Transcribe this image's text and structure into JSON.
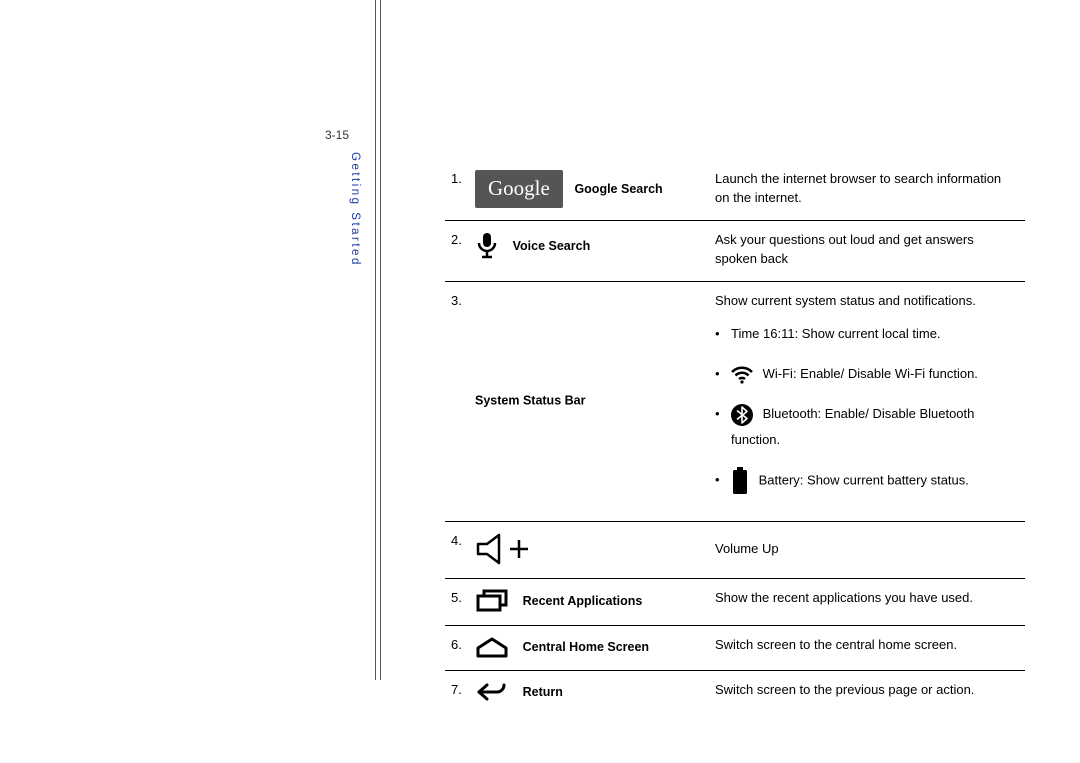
{
  "page_number": "3-15",
  "section_title": "Getting Started",
  "items": [
    {
      "num": "1.",
      "label": "Google Search",
      "logo_text": "Google",
      "desc": "Launch the internet browser to search information on the internet."
    },
    {
      "num": "2.",
      "label": "Voice Search",
      "desc": "Ask your questions out loud and get answers spoken back"
    },
    {
      "num": "3.",
      "label": "System Status Bar",
      "desc": "Show current system status and notifications.",
      "bullets": {
        "time": "Time 16:11: Show current local time.",
        "wifi": "Wi-Fi: Enable/ Disable Wi-Fi function.",
        "bt": "Bluetooth: Enable/ Disable Bluetooth function.",
        "batt": "Battery: Show current battery status."
      }
    },
    {
      "num": "4.",
      "label": "",
      "desc": "Volume Up"
    },
    {
      "num": "5.",
      "label": "Recent Applications",
      "desc": "Show the recent applications you have used."
    },
    {
      "num": "6.",
      "label": "Central Home Screen",
      "desc": "Switch screen to the central home screen."
    },
    {
      "num": "7.",
      "label": "Return",
      "desc": "Switch screen to the previous page or action."
    }
  ]
}
